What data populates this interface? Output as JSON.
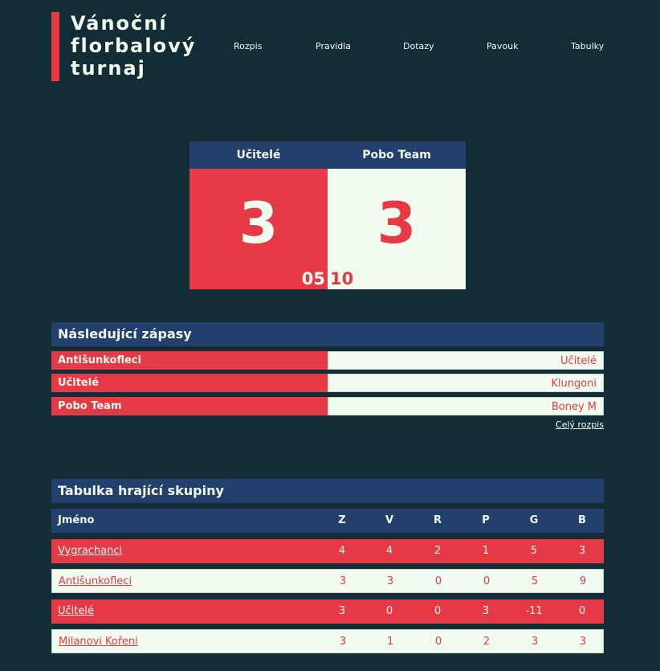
{
  "site": {
    "title": "Vánoční\nflorbalový\nturnaj",
    "nav": [
      "Rozpis",
      "Pravidla",
      "Dotazy",
      "Pavouk",
      "Tabulky"
    ]
  },
  "live_match": {
    "home_team": "Učitelé",
    "away_team": "Pobo Team",
    "home_score": "3",
    "away_score": "3",
    "time_minutes": "05",
    "time_seconds": "10"
  },
  "upcoming": {
    "heading": "Následující zápasy",
    "matches": [
      {
        "home": "Antišunkofleci",
        "away": "Učitelé"
      },
      {
        "home": "Učitelé",
        "away": "Klungoni"
      },
      {
        "home": "Pobo Team",
        "away": "Boney M"
      }
    ],
    "full_schedule_link": "Celý rozpis"
  },
  "group_table": {
    "heading": "Tabulka hrající skupiny",
    "columns": [
      "Jméno",
      "Z",
      "V",
      "R",
      "P",
      "G",
      "B"
    ],
    "rows": [
      [
        "Vygrachanci",
        "4",
        "4",
        "2",
        "1",
        "5",
        "3"
      ],
      [
        "Antišunkofleci",
        "3",
        "3",
        "0",
        "0",
        "5",
        "9"
      ],
      [
        "Učitelé",
        "3",
        "0",
        "0",
        "3",
        "-11",
        "0"
      ],
      [
        "Milanovi Kořeni",
        "3",
        "1",
        "0",
        "2",
        "3",
        "3"
      ]
    ]
  },
  "colors": {
    "background": "#132d37",
    "accent_red": "#e63946",
    "navy": "#233f6e",
    "light": "#f1faee"
  }
}
